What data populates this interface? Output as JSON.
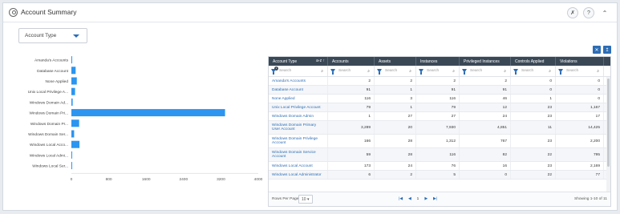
{
  "header": {
    "title": "Account Summary",
    "help_label": "?"
  },
  "filter": {
    "dropdown_value": "Account Type"
  },
  "chart_data": {
    "type": "bar",
    "orientation": "horizontal",
    "categories": [
      "Amanda's Accounts",
      "Database Account",
      "None Applied",
      "Unix Local Privilege A...",
      "Windows Domain Ad...",
      "Windows Domain Pri...",
      "Windows Domain Pr...",
      "Windows Domain Ser...",
      "Windows Local Acco...",
      "Windows Local Admi...",
      "Windows Local Ser..."
    ],
    "values": [
      2,
      91,
      116,
      79,
      27,
      3289,
      166,
      59,
      173,
      6,
      5
    ],
    "xticks": [
      "0",
      "800",
      "1600",
      "2400",
      "3200",
      "4000"
    ],
    "xlim": [
      0,
      4000
    ],
    "color": "#2b95f0",
    "grid": false
  },
  "table": {
    "columns": [
      "Account Type",
      "Accounts",
      "Assets",
      "Instances",
      "Privileged Instances",
      "Controls Applied",
      "Violations"
    ],
    "sort_indicator": "a-z",
    "filter_badge": "1",
    "search_placeholder": "Search",
    "rows": [
      [
        "Amanda's Accounts",
        "2",
        "2",
        "2",
        "2",
        "0",
        "0"
      ],
      [
        "Database Account",
        "91",
        "1",
        "91",
        "91",
        "0",
        "0"
      ],
      [
        "None Applied",
        "116",
        "3",
        "116",
        "46",
        "1",
        "0"
      ],
      [
        "Unix Local Privilege Account",
        "79",
        "1",
        "79",
        "12",
        "23",
        "1,167"
      ],
      [
        "Windows Domain Admin",
        "1",
        "27",
        "27",
        "24",
        "23",
        "17"
      ],
      [
        "Windows Domain Primary User Account",
        "3,289",
        "20",
        "7,930",
        "4,851",
        "11",
        "14,425"
      ],
      [
        "Windows Domain Privilege Account",
        "166",
        "28",
        "1,312",
        "767",
        "23",
        "2,200"
      ],
      [
        "Windows Domain Service Account",
        "59",
        "28",
        "116",
        "82",
        "22",
        "795"
      ],
      [
        "Windows Local Account",
        "173",
        "24",
        "76",
        "16",
        "23",
        "2,169"
      ],
      [
        "Windows Local Administrator",
        "6",
        "2",
        "5",
        "0",
        "22",
        "77"
      ]
    ]
  },
  "footer": {
    "rows_per_page_label": "Rows Per Page:",
    "rows_per_page_value": "10",
    "page_number": "1",
    "showing": "Showing 1-10 of 11"
  }
}
